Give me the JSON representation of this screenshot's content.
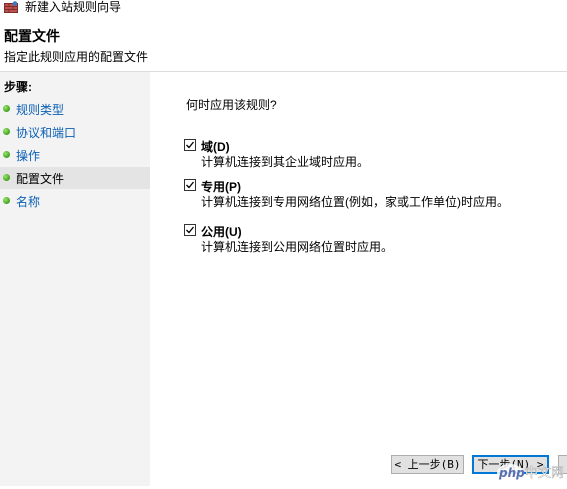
{
  "window": {
    "title": "新建入站规则向导",
    "icon": "firewall-wizard-icon"
  },
  "header": {
    "title": "配置文件",
    "subtitle": "指定此规则应用的配置文件"
  },
  "steps": {
    "label": "步骤:",
    "items": [
      {
        "label": "规则类型",
        "current": false
      },
      {
        "label": "协议和端口",
        "current": false
      },
      {
        "label": "操作",
        "current": false
      },
      {
        "label": "配置文件",
        "current": true
      },
      {
        "label": "名称",
        "current": false
      }
    ]
  },
  "main": {
    "question": "何时应用该规则?",
    "options": [
      {
        "label": "域(D)",
        "description": "计算机连接到其企业域时应用。",
        "checked": true
      },
      {
        "label": "专用(P)",
        "description": "计算机连接到专用网络位置(例如，家或工作单位)时应用。",
        "checked": true
      },
      {
        "label": "公用(U)",
        "description": "计算机连接到公用网络位置时应用。",
        "checked": true
      }
    ]
  },
  "buttons": {
    "back": "< 上一步(B)",
    "next": "下一步(N) >"
  },
  "watermark": {
    "text": "php中文网"
  },
  "colors": {
    "accent": "#0078d7",
    "link": "#0b5fb5",
    "step_panel": "#f3f3f3",
    "step_dot": "#3ca11d"
  }
}
